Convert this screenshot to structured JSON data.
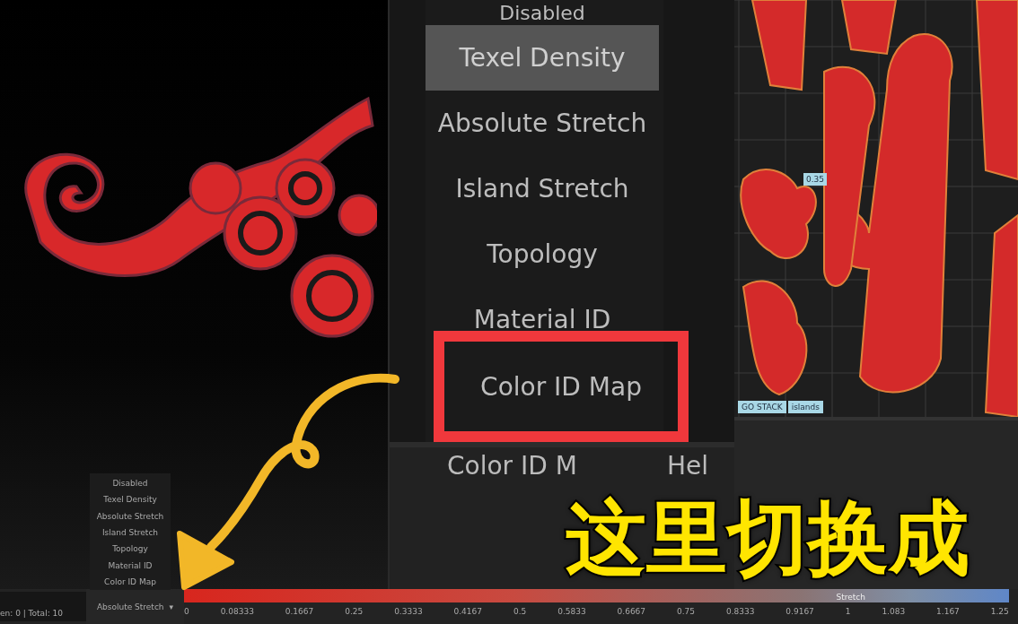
{
  "zoom_inset": {
    "items": [
      {
        "label": "Disabled",
        "selected": false,
        "highlighted": false
      },
      {
        "label": "Texel Density",
        "selected": true,
        "highlighted": false
      },
      {
        "label": "Absolute Stretch",
        "selected": false,
        "highlighted": false
      },
      {
        "label": "Island Stretch",
        "selected": false,
        "highlighted": false
      },
      {
        "label": "Topology",
        "selected": false,
        "highlighted": false
      },
      {
        "label": "Material ID",
        "selected": false,
        "highlighted": false
      },
      {
        "label": "Color ID Map",
        "selected": false,
        "highlighted": true
      }
    ],
    "lower_labels": [
      "Color ID M",
      "Hel"
    ]
  },
  "uv_view": {
    "tag": "0.35",
    "toolbar": [
      "GO STACK",
      "islands"
    ]
  },
  "stretch_menu": {
    "items": [
      "Disabled",
      "Texel Density",
      "Absolute Stretch",
      "Island Stretch",
      "Topology",
      "Material ID",
      "Color ID Map"
    ],
    "value": "Absolute Stretch",
    "caret": "▾"
  },
  "status_bar": {
    "text": "en: 0 | Total: 10"
  },
  "color_scale": {
    "label": "Stretch",
    "ticks": [
      "0",
      "0.08333",
      "0.1667",
      "0.25",
      "0.3333",
      "0.4167",
      "0.5",
      "0.5833",
      "0.6667",
      "0.75",
      "0.8333",
      "0.9167",
      "1",
      "1.083",
      "1.167",
      "1.25"
    ]
  },
  "annotation": {
    "caption": "这里切换成"
  }
}
